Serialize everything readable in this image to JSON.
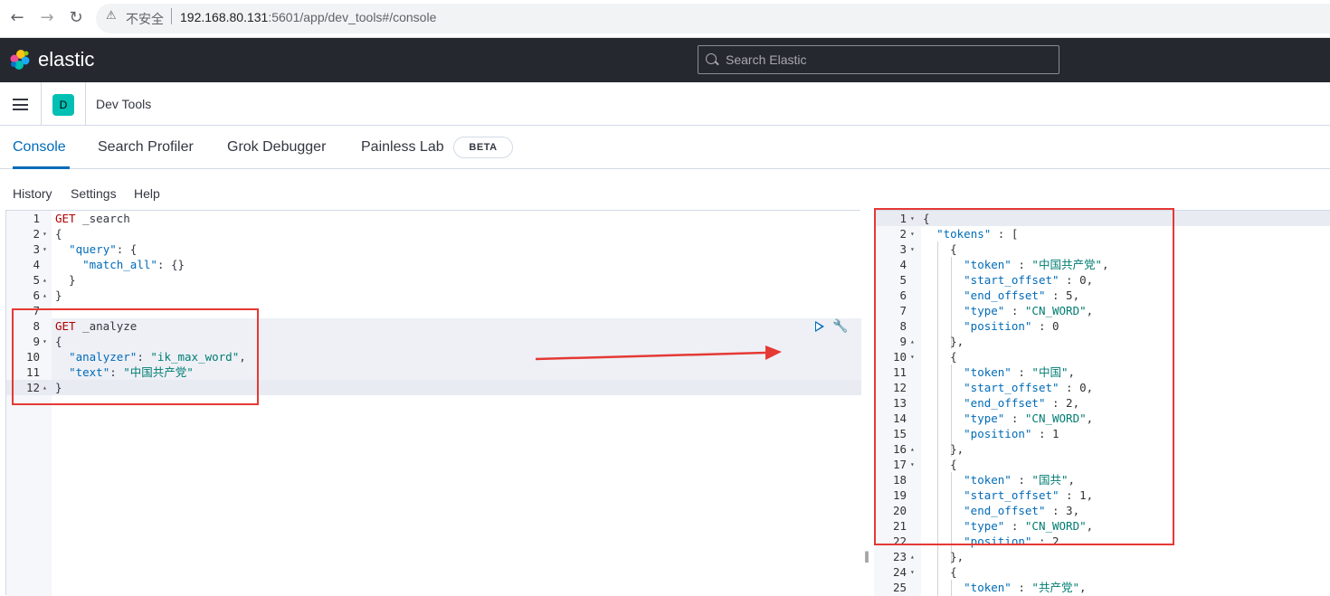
{
  "browser": {
    "back_icon": "arrow-left-icon",
    "forward_icon": "arrow-right-icon",
    "reload_icon": "reload-icon",
    "security_label": "不安全",
    "url_host": "192.168.80.131",
    "url_rest": ":5601/app/dev_tools#/console"
  },
  "header": {
    "brand": "elastic",
    "search_placeholder": "Search Elastic"
  },
  "breadcrumb": {
    "avatar_letter": "D",
    "title": "Dev Tools"
  },
  "tabs": [
    {
      "label": "Console",
      "active": true
    },
    {
      "label": "Search Profiler",
      "active": false
    },
    {
      "label": "Grok Debugger",
      "active": false
    },
    {
      "label": "Painless Lab",
      "active": false
    }
  ],
  "beta_badge": "BETA",
  "menu": [
    "History",
    "Settings",
    "Help"
  ],
  "editor": {
    "lines": [
      {
        "n": "1",
        "fold": "",
        "tokens": [
          [
            "m",
            "GET"
          ],
          [
            "p",
            " _search"
          ]
        ]
      },
      {
        "n": "2",
        "fold": "▾",
        "tokens": [
          [
            "p",
            "{"
          ]
        ]
      },
      {
        "n": "3",
        "fold": "▾",
        "tokens": [
          [
            "p",
            "  "
          ],
          [
            "k",
            "\"query\""
          ],
          [
            "p",
            ": {"
          ]
        ]
      },
      {
        "n": "4",
        "fold": "",
        "tokens": [
          [
            "p",
            "    "
          ],
          [
            "k",
            "\"match_all\""
          ],
          [
            "p",
            ": {}"
          ]
        ]
      },
      {
        "n": "5",
        "fold": "▴",
        "tokens": [
          [
            "p",
            "  }"
          ]
        ]
      },
      {
        "n": "6",
        "fold": "▴",
        "tokens": [
          [
            "p",
            "}"
          ]
        ]
      },
      {
        "n": "7",
        "fold": "",
        "tokens": []
      },
      {
        "n": "8",
        "fold": "",
        "tokens": [
          [
            "m",
            "GET"
          ],
          [
            "p",
            " _analyze"
          ]
        ]
      },
      {
        "n": "9",
        "fold": "▾",
        "tokens": [
          [
            "p",
            "{"
          ]
        ]
      },
      {
        "n": "10",
        "fold": "",
        "tokens": [
          [
            "p",
            "  "
          ],
          [
            "k",
            "\"analyzer\""
          ],
          [
            "p",
            ": "
          ],
          [
            "s",
            "\"ik_max_word\""
          ],
          [
            "p",
            ","
          ]
        ]
      },
      {
        "n": "11",
        "fold": "",
        "tokens": [
          [
            "p",
            "  "
          ],
          [
            "k",
            "\"text\""
          ],
          [
            "p",
            ": "
          ],
          [
            "s",
            "\"中国共产党\""
          ]
        ]
      },
      {
        "n": "12",
        "fold": "▴",
        "tokens": [
          [
            "p",
            "}"
          ]
        ]
      }
    ]
  },
  "output": {
    "lines": [
      {
        "n": "1",
        "fold": "▾",
        "tokens": [
          [
            "pn",
            "{"
          ]
        ]
      },
      {
        "n": "2",
        "fold": "▾",
        "tokens": [
          [
            "pn",
            "  "
          ],
          [
            "k",
            "\"tokens\""
          ],
          [
            "pn",
            " : ["
          ]
        ]
      },
      {
        "n": "3",
        "fold": "▾",
        "tokens": [
          [
            "pn",
            "    {"
          ]
        ]
      },
      {
        "n": "4",
        "fold": "",
        "tokens": [
          [
            "pn",
            "      "
          ],
          [
            "k",
            "\"token\""
          ],
          [
            "pn",
            " : "
          ],
          [
            "s",
            "\"中国共产党\""
          ],
          [
            "pn",
            ","
          ]
        ]
      },
      {
        "n": "5",
        "fold": "",
        "tokens": [
          [
            "pn",
            "      "
          ],
          [
            "k",
            "\"start_offset\""
          ],
          [
            "pn",
            " : 0,"
          ]
        ]
      },
      {
        "n": "6",
        "fold": "",
        "tokens": [
          [
            "pn",
            "      "
          ],
          [
            "k",
            "\"end_offset\""
          ],
          [
            "pn",
            " : 5,"
          ]
        ]
      },
      {
        "n": "7",
        "fold": "",
        "tokens": [
          [
            "pn",
            "      "
          ],
          [
            "k",
            "\"type\""
          ],
          [
            "pn",
            " : "
          ],
          [
            "s",
            "\"CN_WORD\""
          ],
          [
            "pn",
            ","
          ]
        ]
      },
      {
        "n": "8",
        "fold": "",
        "tokens": [
          [
            "pn",
            "      "
          ],
          [
            "k",
            "\"position\""
          ],
          [
            "pn",
            " : 0"
          ]
        ]
      },
      {
        "n": "9",
        "fold": "▴",
        "tokens": [
          [
            "pn",
            "    },"
          ]
        ]
      },
      {
        "n": "10",
        "fold": "▾",
        "tokens": [
          [
            "pn",
            "    {"
          ]
        ]
      },
      {
        "n": "11",
        "fold": "",
        "tokens": [
          [
            "pn",
            "      "
          ],
          [
            "k",
            "\"token\""
          ],
          [
            "pn",
            " : "
          ],
          [
            "s",
            "\"中国\""
          ],
          [
            "pn",
            ","
          ]
        ]
      },
      {
        "n": "12",
        "fold": "",
        "tokens": [
          [
            "pn",
            "      "
          ],
          [
            "k",
            "\"start_offset\""
          ],
          [
            "pn",
            " : 0,"
          ]
        ]
      },
      {
        "n": "13",
        "fold": "",
        "tokens": [
          [
            "pn",
            "      "
          ],
          [
            "k",
            "\"end_offset\""
          ],
          [
            "pn",
            " : 2,"
          ]
        ]
      },
      {
        "n": "14",
        "fold": "",
        "tokens": [
          [
            "pn",
            "      "
          ],
          [
            "k",
            "\"type\""
          ],
          [
            "pn",
            " : "
          ],
          [
            "s",
            "\"CN_WORD\""
          ],
          [
            "pn",
            ","
          ]
        ]
      },
      {
        "n": "15",
        "fold": "",
        "tokens": [
          [
            "pn",
            "      "
          ],
          [
            "k",
            "\"position\""
          ],
          [
            "pn",
            " : 1"
          ]
        ]
      },
      {
        "n": "16",
        "fold": "▴",
        "tokens": [
          [
            "pn",
            "    },"
          ]
        ]
      },
      {
        "n": "17",
        "fold": "▾",
        "tokens": [
          [
            "pn",
            "    {"
          ]
        ]
      },
      {
        "n": "18",
        "fold": "",
        "tokens": [
          [
            "pn",
            "      "
          ],
          [
            "k",
            "\"token\""
          ],
          [
            "pn",
            " : "
          ],
          [
            "s",
            "\"国共\""
          ],
          [
            "pn",
            ","
          ]
        ]
      },
      {
        "n": "19",
        "fold": "",
        "tokens": [
          [
            "pn",
            "      "
          ],
          [
            "k",
            "\"start_offset\""
          ],
          [
            "pn",
            " : 1,"
          ]
        ]
      },
      {
        "n": "20",
        "fold": "",
        "tokens": [
          [
            "pn",
            "      "
          ],
          [
            "k",
            "\"end_offset\""
          ],
          [
            "pn",
            " : 3,"
          ]
        ]
      },
      {
        "n": "21",
        "fold": "",
        "tokens": [
          [
            "pn",
            "      "
          ],
          [
            "k",
            "\"type\""
          ],
          [
            "pn",
            " : "
          ],
          [
            "s",
            "\"CN_WORD\""
          ],
          [
            "pn",
            ","
          ]
        ]
      },
      {
        "n": "22",
        "fold": "",
        "tokens": [
          [
            "pn",
            "      "
          ],
          [
            "k",
            "\"position\""
          ],
          [
            "pn",
            " : 2"
          ]
        ]
      },
      {
        "n": "23",
        "fold": "▴",
        "tokens": [
          [
            "pn",
            "    },"
          ]
        ]
      },
      {
        "n": "24",
        "fold": "▾",
        "tokens": [
          [
            "pn",
            "    {"
          ]
        ]
      },
      {
        "n": "25",
        "fold": "",
        "tokens": [
          [
            "pn",
            "      "
          ],
          [
            "k",
            "\"token\""
          ],
          [
            "pn",
            " : "
          ],
          [
            "s",
            "\"共产党\""
          ],
          [
            "pn",
            ","
          ]
        ]
      }
    ]
  },
  "colors": {
    "header_bg": "#25282f",
    "accent": "#006bb8",
    "annotation_red": "#e53935",
    "avatar": "#00bfb3"
  }
}
